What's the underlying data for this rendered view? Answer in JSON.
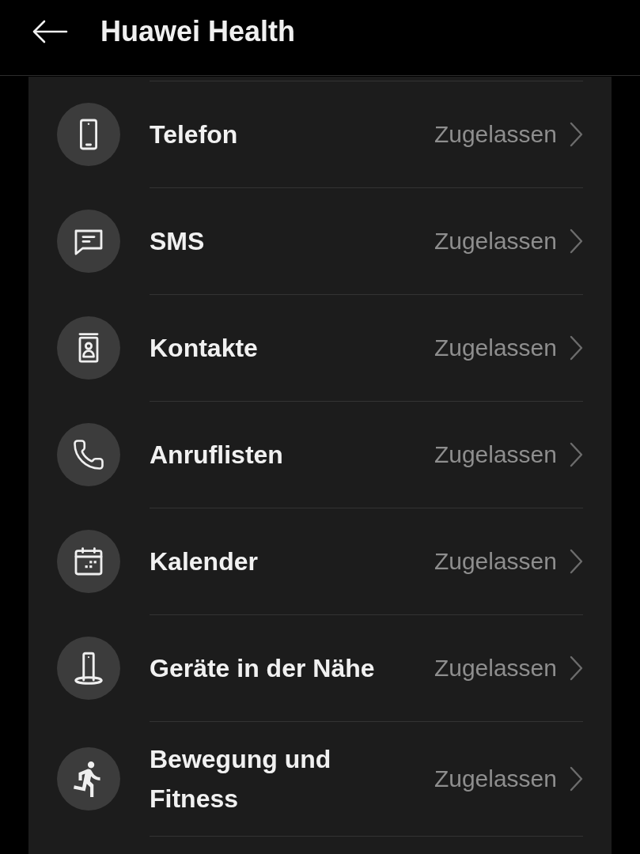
{
  "header": {
    "title": "Huawei Health"
  },
  "permissions": [
    {
      "label": "Telefon",
      "status": "Zugelassen"
    },
    {
      "label": "SMS",
      "status": "Zugelassen"
    },
    {
      "label": "Kontakte",
      "status": "Zugelassen"
    },
    {
      "label": "Anruflisten",
      "status": "Zugelassen"
    },
    {
      "label": "Kalender",
      "status": "Zugelassen"
    },
    {
      "label": "Geräte in der Nähe",
      "status": "Zugelassen"
    },
    {
      "label": "Bewegung und Fitness",
      "status": "Zugelassen"
    }
  ]
}
